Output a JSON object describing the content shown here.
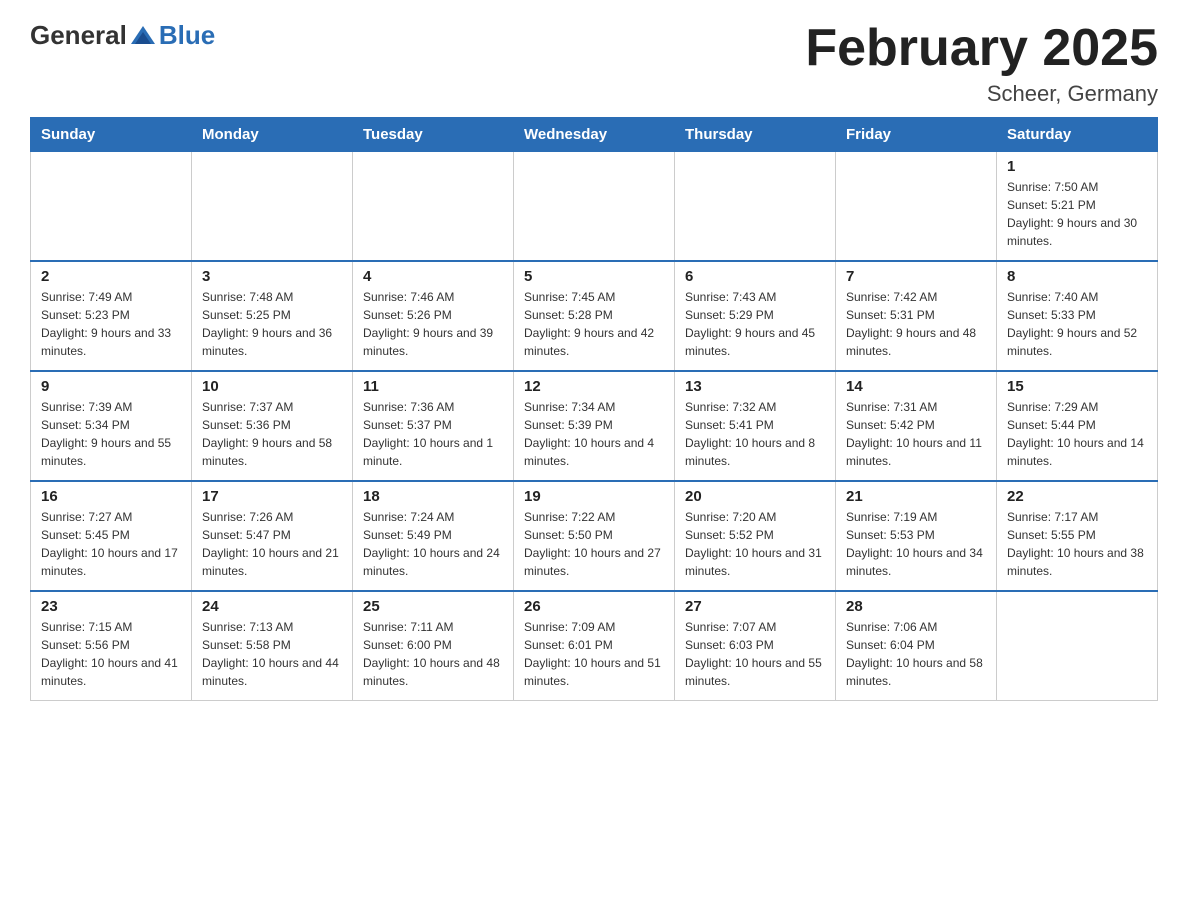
{
  "logo": {
    "general": "General",
    "blue": "Blue"
  },
  "title": "February 2025",
  "location": "Scheer, Germany",
  "weekdays": [
    "Sunday",
    "Monday",
    "Tuesday",
    "Wednesday",
    "Thursday",
    "Friday",
    "Saturday"
  ],
  "weeks": [
    [
      {
        "day": "",
        "info": ""
      },
      {
        "day": "",
        "info": ""
      },
      {
        "day": "",
        "info": ""
      },
      {
        "day": "",
        "info": ""
      },
      {
        "day": "",
        "info": ""
      },
      {
        "day": "",
        "info": ""
      },
      {
        "day": "1",
        "info": "Sunrise: 7:50 AM\nSunset: 5:21 PM\nDaylight: 9 hours and 30 minutes."
      }
    ],
    [
      {
        "day": "2",
        "info": "Sunrise: 7:49 AM\nSunset: 5:23 PM\nDaylight: 9 hours and 33 minutes."
      },
      {
        "day": "3",
        "info": "Sunrise: 7:48 AM\nSunset: 5:25 PM\nDaylight: 9 hours and 36 minutes."
      },
      {
        "day": "4",
        "info": "Sunrise: 7:46 AM\nSunset: 5:26 PM\nDaylight: 9 hours and 39 minutes."
      },
      {
        "day": "5",
        "info": "Sunrise: 7:45 AM\nSunset: 5:28 PM\nDaylight: 9 hours and 42 minutes."
      },
      {
        "day": "6",
        "info": "Sunrise: 7:43 AM\nSunset: 5:29 PM\nDaylight: 9 hours and 45 minutes."
      },
      {
        "day": "7",
        "info": "Sunrise: 7:42 AM\nSunset: 5:31 PM\nDaylight: 9 hours and 48 minutes."
      },
      {
        "day": "8",
        "info": "Sunrise: 7:40 AM\nSunset: 5:33 PM\nDaylight: 9 hours and 52 minutes."
      }
    ],
    [
      {
        "day": "9",
        "info": "Sunrise: 7:39 AM\nSunset: 5:34 PM\nDaylight: 9 hours and 55 minutes."
      },
      {
        "day": "10",
        "info": "Sunrise: 7:37 AM\nSunset: 5:36 PM\nDaylight: 9 hours and 58 minutes."
      },
      {
        "day": "11",
        "info": "Sunrise: 7:36 AM\nSunset: 5:37 PM\nDaylight: 10 hours and 1 minute."
      },
      {
        "day": "12",
        "info": "Sunrise: 7:34 AM\nSunset: 5:39 PM\nDaylight: 10 hours and 4 minutes."
      },
      {
        "day": "13",
        "info": "Sunrise: 7:32 AM\nSunset: 5:41 PM\nDaylight: 10 hours and 8 minutes."
      },
      {
        "day": "14",
        "info": "Sunrise: 7:31 AM\nSunset: 5:42 PM\nDaylight: 10 hours and 11 minutes."
      },
      {
        "day": "15",
        "info": "Sunrise: 7:29 AM\nSunset: 5:44 PM\nDaylight: 10 hours and 14 minutes."
      }
    ],
    [
      {
        "day": "16",
        "info": "Sunrise: 7:27 AM\nSunset: 5:45 PM\nDaylight: 10 hours and 17 minutes."
      },
      {
        "day": "17",
        "info": "Sunrise: 7:26 AM\nSunset: 5:47 PM\nDaylight: 10 hours and 21 minutes."
      },
      {
        "day": "18",
        "info": "Sunrise: 7:24 AM\nSunset: 5:49 PM\nDaylight: 10 hours and 24 minutes."
      },
      {
        "day": "19",
        "info": "Sunrise: 7:22 AM\nSunset: 5:50 PM\nDaylight: 10 hours and 27 minutes."
      },
      {
        "day": "20",
        "info": "Sunrise: 7:20 AM\nSunset: 5:52 PM\nDaylight: 10 hours and 31 minutes."
      },
      {
        "day": "21",
        "info": "Sunrise: 7:19 AM\nSunset: 5:53 PM\nDaylight: 10 hours and 34 minutes."
      },
      {
        "day": "22",
        "info": "Sunrise: 7:17 AM\nSunset: 5:55 PM\nDaylight: 10 hours and 38 minutes."
      }
    ],
    [
      {
        "day": "23",
        "info": "Sunrise: 7:15 AM\nSunset: 5:56 PM\nDaylight: 10 hours and 41 minutes."
      },
      {
        "day": "24",
        "info": "Sunrise: 7:13 AM\nSunset: 5:58 PM\nDaylight: 10 hours and 44 minutes."
      },
      {
        "day": "25",
        "info": "Sunrise: 7:11 AM\nSunset: 6:00 PM\nDaylight: 10 hours and 48 minutes."
      },
      {
        "day": "26",
        "info": "Sunrise: 7:09 AM\nSunset: 6:01 PM\nDaylight: 10 hours and 51 minutes."
      },
      {
        "day": "27",
        "info": "Sunrise: 7:07 AM\nSunset: 6:03 PM\nDaylight: 10 hours and 55 minutes."
      },
      {
        "day": "28",
        "info": "Sunrise: 7:06 AM\nSunset: 6:04 PM\nDaylight: 10 hours and 58 minutes."
      },
      {
        "day": "",
        "info": ""
      }
    ]
  ]
}
